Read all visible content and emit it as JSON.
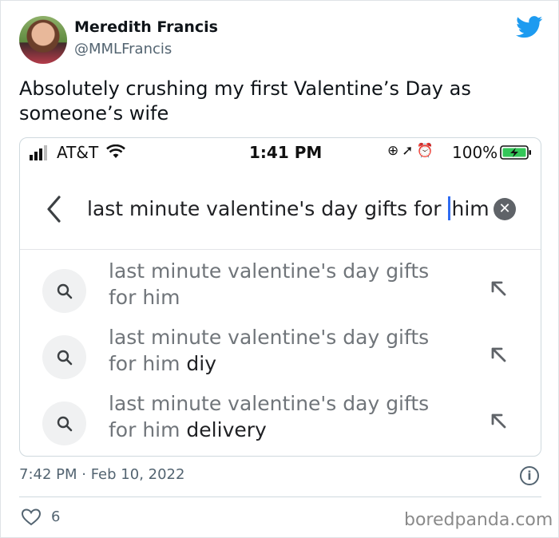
{
  "tweet": {
    "author_name": "Meredith Francis",
    "author_handle": "@MMLFrancis",
    "text": "Absolutely crushing my first Valentine’s Day as someone’s wife",
    "timestamp": "7:42 PM · Feb 10, 2022",
    "like_count": "6",
    "brand_color": "#1d9bf0"
  },
  "phone": {
    "status": {
      "carrier": "AT&T",
      "time": "1:41 PM",
      "battery": "100%"
    },
    "search": {
      "query_main": "last minute valentine's day gifts for ",
      "query_tail": "him"
    },
    "suggestions": [
      {
        "prefix": "last minute valentine's day gifts for him",
        "suffix": ""
      },
      {
        "prefix": "last minute valentine's day gifts for him ",
        "suffix": "diy"
      },
      {
        "prefix": "last minute valentine's day gifts for him ",
        "suffix": "delivery"
      }
    ]
  },
  "watermark": "boredpanda.com"
}
